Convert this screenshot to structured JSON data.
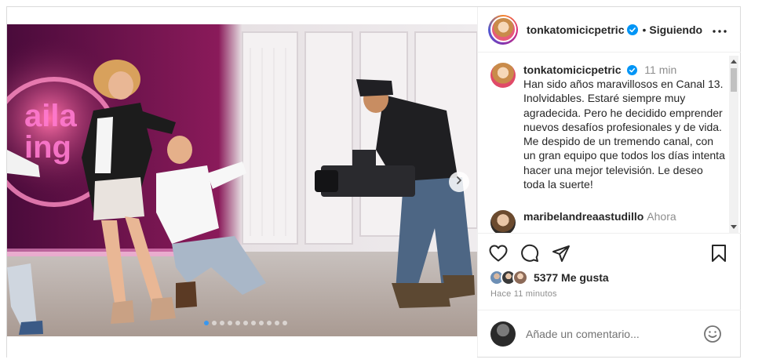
{
  "post": {
    "username": "tonkatomicicpetric",
    "follow_status": "Siguiendo",
    "separator": "•",
    "caption": {
      "username": "tonkatomicicpetric",
      "time": "11 min",
      "text": "Han sido años maravillosos en Canal 13. Inolvidables. Estaré siempre muy agradecida. Pero he decidido emprender nuevos desafíos profesionales y de vida. Me despido de un tremendo canal, con un gran equipo que todos los días intenta hacer una mejor televisión. Le deseo toda la suerte!"
    },
    "comments": [
      {
        "username": "maribelandreaastudillo",
        "time": "Ahora"
      }
    ],
    "likes": "5377 Me gusta",
    "posted_time": "Hace 11 minutos",
    "comment_placeholder": "Añade un comentario...",
    "carousel": {
      "total": 11,
      "active_index": 0
    },
    "icons": {
      "more": "more-options-icon",
      "verified": "verified-badge-icon",
      "like": "heart-icon",
      "comment": "comment-bubble-icon",
      "share": "paper-plane-icon",
      "save": "bookmark-icon",
      "emoji": "emoji-smiley-icon",
      "next": "chevron-right-icon"
    },
    "colors": {
      "verified_blue": "#0095f6",
      "secondary_text": "#8e8e8e",
      "border": "#dbdbdb"
    }
  }
}
